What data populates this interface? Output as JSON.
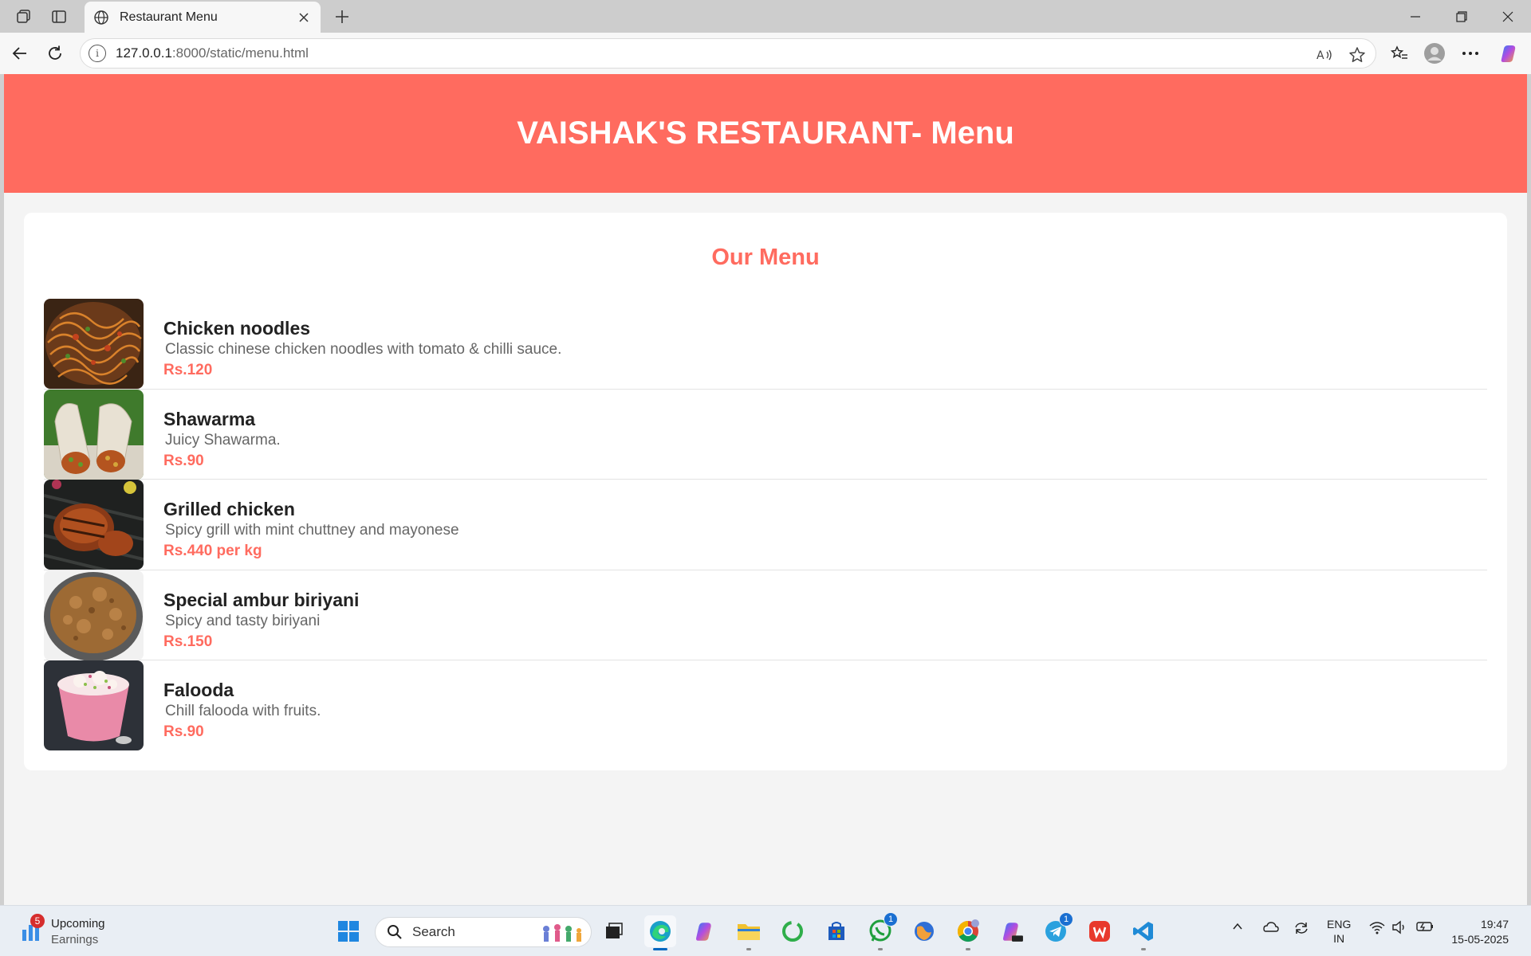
{
  "browser": {
    "tab_title": "Restaurant Menu",
    "url_host": "127.0.0.1",
    "url_path": ":8000/static/menu.html"
  },
  "page": {
    "header_title": "VAISHAK'S RESTAURANT- Menu",
    "menu_heading": "Our Menu",
    "accent_color": "#ff6b5f",
    "items": [
      {
        "name": "Chicken noodles",
        "description": "Classic chinese chicken noodles with tomato & chilli sauce.",
        "price": "Rs.120",
        "image_icon": "chicken-noodles-photo"
      },
      {
        "name": "Shawarma",
        "description": "Juicy Shawarma.",
        "price": "Rs.90",
        "image_icon": "shawarma-photo"
      },
      {
        "name": "Grilled chicken",
        "description": "Spicy grill with mint chuttney and mayonese",
        "price": "Rs.440 per kg",
        "image_icon": "grilled-chicken-photo"
      },
      {
        "name": "Special ambur biriyani",
        "description": "Spicy and tasty biriyani",
        "price": "Rs.150",
        "image_icon": "biriyani-photo"
      },
      {
        "name": "Falooda",
        "description": "Chill falooda with fruits.",
        "price": "Rs.90",
        "image_icon": "falooda-photo"
      }
    ]
  },
  "taskbar": {
    "weather_badge": "5",
    "weather_title": "Upcoming",
    "weather_sub": "Earnings",
    "search_label": "Search",
    "whatsapp_badge": "1",
    "telegram_badge": "1",
    "lang_top": "ENG",
    "lang_bottom": "IN",
    "time": "19:47",
    "date": "15-05-2025"
  }
}
